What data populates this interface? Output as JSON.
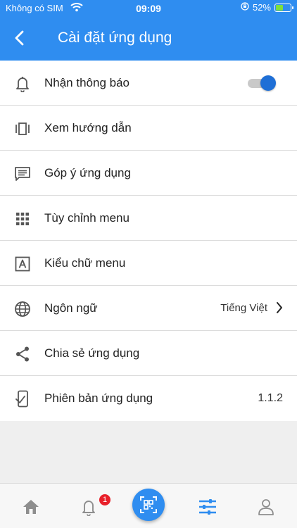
{
  "status_bar": {
    "carrier": "Không có SIM",
    "time": "09:09",
    "battery_percent": "52%",
    "battery_level": 0.52
  },
  "header": {
    "title": "Cài đặt ứng dụng"
  },
  "settings": [
    {
      "id": "notifications",
      "label": "Nhận thông báo",
      "icon": "bell-icon",
      "toggle_on": true
    },
    {
      "id": "guide",
      "label": "Xem hướng dẫn",
      "icon": "carousel-icon"
    },
    {
      "id": "feedback",
      "label": "Góp ý ứng dụng",
      "icon": "message-icon"
    },
    {
      "id": "customize-menu",
      "label": "Tùy chỉnh menu",
      "icon": "grid-icon"
    },
    {
      "id": "menu-font",
      "label": "Kiểu chữ menu",
      "icon": "font-icon"
    },
    {
      "id": "language",
      "label": "Ngôn ngữ",
      "value": "Tiếng Việt",
      "icon": "globe-icon"
    },
    {
      "id": "share",
      "label": "Chia sẻ ứng dụng",
      "icon": "share-icon"
    },
    {
      "id": "version",
      "label": "Phiên bản ứng dụng",
      "value": "1.1.2",
      "icon": "phone-check-icon"
    }
  ],
  "tab_bar": {
    "notification_badge": "1",
    "tabs": [
      "home-icon",
      "bell-icon",
      "qr-scan-icon",
      "settings-sliders-icon",
      "user-icon"
    ],
    "active_tab": "settings-sliders-icon"
  },
  "colors": {
    "primary": "#2f8df0",
    "toggle_on": "#1f6fd6",
    "badge": "#e8202a",
    "background": "#efefef"
  }
}
